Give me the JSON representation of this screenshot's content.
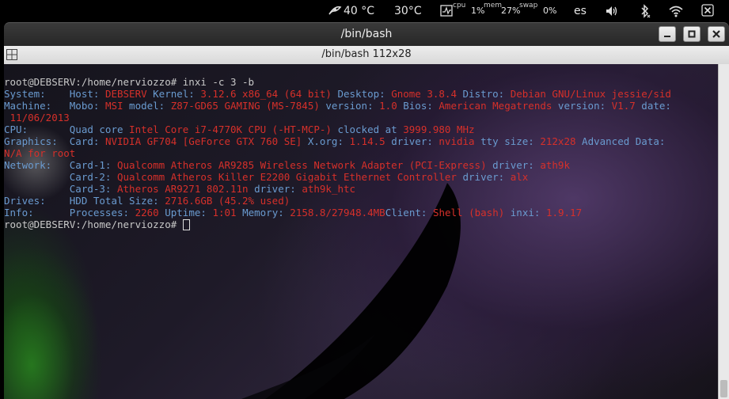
{
  "topbar": {
    "temp1": "40 °C",
    "temp2": "30°C",
    "cpu_label": "cpu",
    "cpu_value": "1%",
    "mem_label": "mem",
    "mem_value": "27%",
    "swap_label": "swap",
    "swap_value": "0%",
    "keyboard_layout": "es",
    "icons": [
      "gpu-icon",
      "cpu-monitor-icon",
      "volume-icon",
      "bluetooth-icon",
      "wifi-icon",
      "close-session-icon"
    ]
  },
  "window": {
    "title": "/bin/bash",
    "tab_title": "/bin/bash 112x28",
    "buttons": {
      "minimize": "–",
      "maximize": "□",
      "close": "✕"
    }
  },
  "terminal": {
    "prompt": "root@DEBSERV:/home/nerviozzo#",
    "command": " inxi -c 3 -b",
    "lines": [
      {
        "seg": [
          [
            "b",
            "System:    Host: "
          ],
          [
            "r",
            "DEBSERV "
          ],
          [
            "b",
            "Kernel: "
          ],
          [
            "r",
            "3.12.6 x86_64 (64 bit) "
          ],
          [
            "b",
            "Desktop: "
          ],
          [
            "r",
            "Gnome 3.8.4 "
          ],
          [
            "b",
            "Distro: "
          ],
          [
            "r",
            "Debian GNU/Linux jessie/sid"
          ]
        ]
      },
      {
        "seg": [
          [
            "b",
            "Machine:   Mobo: "
          ],
          [
            "r",
            "MSI "
          ],
          [
            "b",
            "model: "
          ],
          [
            "r",
            "Z87-GD65 GAMING (MS-7845) "
          ],
          [
            "b",
            "version: "
          ],
          [
            "r",
            "1.0 "
          ],
          [
            "b",
            "Bios: "
          ],
          [
            "r",
            "American Megatrends "
          ],
          [
            "b",
            "version: "
          ],
          [
            "r",
            "V1.7 "
          ],
          [
            "b",
            "date:"
          ]
        ]
      },
      {
        "seg": [
          [
            "r",
            " 11/06/2013"
          ]
        ]
      },
      {
        "seg": [
          [
            "b",
            "CPU:       Quad core "
          ],
          [
            "r",
            "Intel Core i7-4770K CPU (-HT-MCP-) "
          ],
          [
            "b",
            "clocked at "
          ],
          [
            "r",
            "3999.980 MHz"
          ]
        ]
      },
      {
        "seg": [
          [
            "b",
            "Graphics:  Card: "
          ],
          [
            "r",
            "NVIDIA GF704 [GeForce GTX 760 SE] "
          ],
          [
            "b",
            "X.org: "
          ],
          [
            "r",
            "1.14.5 "
          ],
          [
            "b",
            "driver: "
          ],
          [
            "r",
            "nvidia "
          ],
          [
            "b",
            "tty size: "
          ],
          [
            "r",
            "212x28 "
          ],
          [
            "b",
            "Advanced Data:"
          ]
        ]
      },
      {
        "seg": [
          [
            "r",
            "N/A for root"
          ]
        ]
      },
      {
        "seg": [
          [
            "b",
            "Network:   Card-1: "
          ],
          [
            "r",
            "Qualcomm Atheros AR9285 Wireless Network Adapter (PCI-Express) "
          ],
          [
            "b",
            "driver: "
          ],
          [
            "r",
            "ath9k"
          ]
        ]
      },
      {
        "seg": [
          [
            "b",
            "           Card-2: "
          ],
          [
            "r",
            "Qualcomm Atheros Killer E2200 Gigabit Ethernet Controller "
          ],
          [
            "b",
            "driver: "
          ],
          [
            "r",
            "alx"
          ]
        ]
      },
      {
        "seg": [
          [
            "b",
            "           Card-3: "
          ],
          [
            "r",
            "Atheros AR9271 802.11n "
          ],
          [
            "b",
            "driver: "
          ],
          [
            "r",
            "ath9k_htc"
          ]
        ]
      },
      {
        "seg": [
          [
            "b",
            "Drives:    HDD Total Size: "
          ],
          [
            "r",
            "2716.6GB (45.2% used)"
          ]
        ]
      },
      {
        "seg": [
          [
            "b",
            "Info:      Processes: "
          ],
          [
            "r",
            "2260 "
          ],
          [
            "b",
            "Uptime: "
          ],
          [
            "r",
            "1:01 "
          ],
          [
            "b",
            "Memory: "
          ],
          [
            "r",
            "2158.8/27948.4MB"
          ],
          [
            "b",
            "Client: "
          ],
          [
            "r",
            "Shell (bash) "
          ],
          [
            "b",
            "inxi: "
          ],
          [
            "r",
            "1.9.17"
          ]
        ]
      }
    ],
    "final_prompt": "root@DEBSERV:/home/nerviozzo#",
    "scroll_position": 1.0
  }
}
